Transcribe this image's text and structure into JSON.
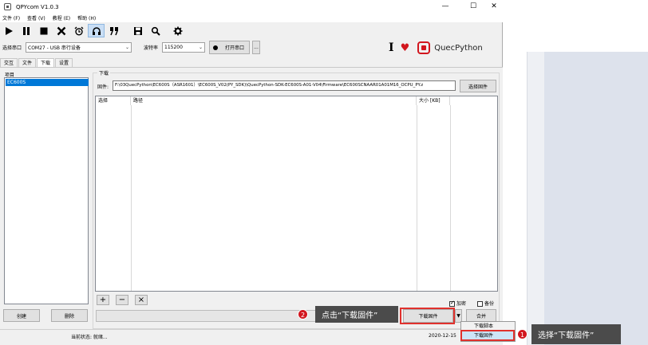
{
  "window": {
    "title": "QPYcom V1.0.3",
    "minimize": "—",
    "maximize": "☐",
    "close": "✕"
  },
  "menu": [
    "文件 (F)",
    "查看 (V)",
    "教程 (E)",
    "帮助 (H)"
  ],
  "toolbar": [
    "play-icon",
    "pause-icon",
    "stop-icon",
    "clear-icon",
    "alarm-icon",
    "headset-icon",
    "quote-icon",
    "save-icon",
    "find-icon",
    "settings-icon"
  ],
  "port": {
    "label": "选择串口",
    "value": "COM27 - USB 串行设备",
    "baud_label": "波特率",
    "baud_value": "115200",
    "open_button": "打开串口",
    "more_button": "..."
  },
  "brand": {
    "cursor": "I",
    "heart": "♥",
    "name": "QuecPython",
    "accent": "#d2161e"
  },
  "tabs": [
    "交互",
    "文件",
    "下载",
    "设置"
  ],
  "project": {
    "header": "项目",
    "items": [
      "EC600S"
    ],
    "create_button": "创建",
    "delete_button": "删除"
  },
  "download": {
    "group_title": "下载",
    "firmware_label": "固件:",
    "firmware_path": "F:\\03QuecPython\\EC600S（ASR1601）\\EC600S_V02(PY_SDK)\\QuecPython-SDK-EC600S-A01-V04\\Firmware\\EC600SCNAAR01A01M16_OCPU_PY.z",
    "choose_button": "选择固件",
    "columns": [
      "选择",
      "路径",
      "大小 [KB]"
    ],
    "add": "+",
    "remove": "−",
    "clear": "×",
    "encrypt_label": "加密",
    "backup_label": "备份",
    "download_button": "下载固件",
    "merge_button": "合并",
    "dropdown_arrow": "▼",
    "menu_items": [
      "下载脚本",
      "下载固件"
    ]
  },
  "status": {
    "text": "当前状态: 就绪...",
    "date": "2020-12-15"
  },
  "annotations": [
    {
      "number": "1",
      "text": "选择“下载固件”"
    },
    {
      "number": "2",
      "text": "点击“下载固件”"
    }
  ]
}
